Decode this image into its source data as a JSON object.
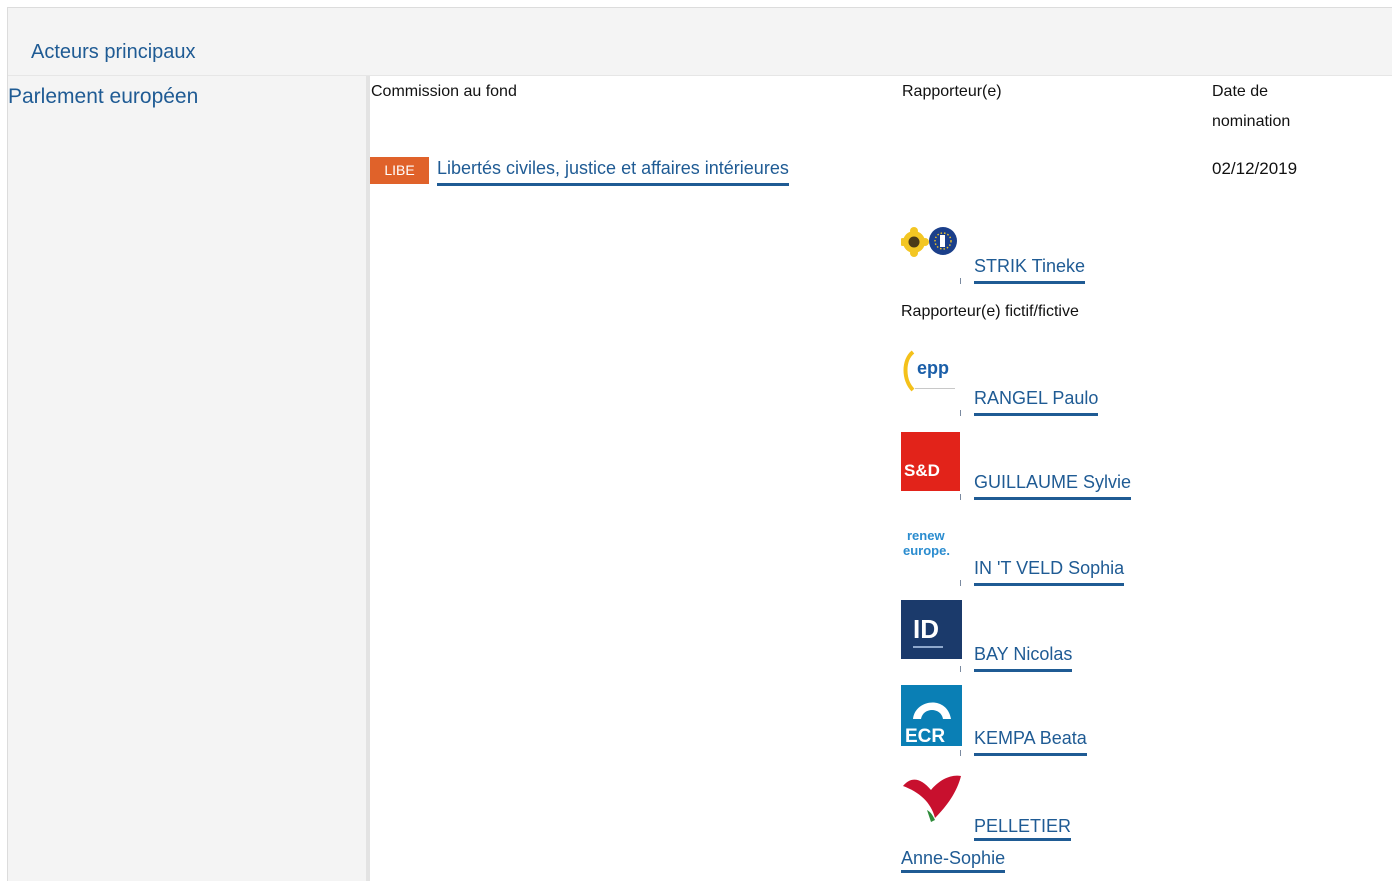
{
  "section": {
    "title": "Acteurs principaux"
  },
  "institution": "Parlement européen",
  "table_headers": {
    "committee": "Commission au fond",
    "rapporteur": "Rapporteur(e)",
    "date_line1": "Date de",
    "date_line2": "nomination"
  },
  "committee": {
    "code": "LIBE",
    "name": "Libertés civiles, justice et affaires intérieures",
    "date": "02/12/2019",
    "badge_color": "#e0622a"
  },
  "rapporteur": {
    "name": "STRIK Tineke",
    "group_icon": "greens-efa-logo-icon"
  },
  "shadow_label": "Rapporteur(e) fictif/fictive",
  "shadow_rapporteurs": [
    {
      "name": "RANGEL Paulo",
      "group_icon": "epp-logo-icon",
      "logo_text": "epp"
    },
    {
      "name": "GUILLAUME Sylvie",
      "group_icon": "sd-logo-icon",
      "logo_text": "S&D"
    },
    {
      "name": "IN 'T VELD Sophia",
      "group_icon": "renew-europe-logo-icon",
      "logo_text_1": "renew",
      "logo_text_2": "europe."
    },
    {
      "name": "BAY Nicolas",
      "group_icon": "id-logo-icon",
      "logo_text": "ID"
    },
    {
      "name": "KEMPA Beata",
      "group_icon": "ecr-logo-icon",
      "logo_text": "ECR"
    },
    {
      "name_part1": "PELLETIER",
      "name_part2": "Anne-Sophie",
      "group_icon": "gue-ngl-logo-icon"
    }
  ],
  "colors": {
    "link": "#1f5b94",
    "sd_red": "#e2231a",
    "id_navy": "#1b3a6b",
    "ecr_blue": "#0a7fb5",
    "epp_blue": "#1a5ea8",
    "renew_blue": "#2a8ccf"
  }
}
